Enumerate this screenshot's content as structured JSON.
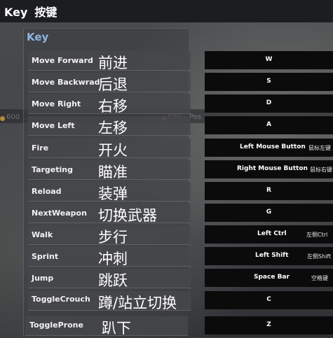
{
  "header": {
    "title_en": "Key",
    "title_zh": "按键"
  },
  "panel": {
    "subtitle": "Key"
  },
  "bindings": [
    {
      "action": "Move Forward",
      "zh": "前进",
      "key": "W"
    },
    {
      "action": "Move Backwrad",
      "zh": "后退",
      "key": "S"
    },
    {
      "action": "Move Right",
      "zh": "右移",
      "key": "D"
    },
    {
      "action": "Move Left",
      "zh": "左移",
      "key": "A"
    },
    {
      "action": "Fire",
      "zh": "开火",
      "key": "Left Mouse Button",
      "key_zh": "鼠标左键"
    },
    {
      "action": "Targeting",
      "zh": "瞄准",
      "key": "Right Mouse Button",
      "key_zh": "鼠标右键"
    },
    {
      "action": "Reload",
      "zh": "装弹",
      "key": "R"
    },
    {
      "action": "NextWeapon",
      "zh": "切换武器",
      "key": "G"
    },
    {
      "action": "Walk",
      "zh": "步行",
      "key": "Left Ctrl",
      "key_zh": "左侧Ctrl"
    },
    {
      "action": "Sprint",
      "zh": "冲刺",
      "key": "Left Shift",
      "key_zh": "左侧Shift"
    },
    {
      "action": "Jump",
      "zh": "跳跃",
      "key": "Space Bar",
      "key_zh": "空格键"
    },
    {
      "action": "ToggleCrouch",
      "zh": "蹲/站立切换",
      "key": "C"
    },
    {
      "action": "ToggleProne",
      "zh": "趴下",
      "key": "Z"
    }
  ],
  "background": {
    "ghost_texts": [
      "600",
      "600",
      "Pos"
    ]
  }
}
